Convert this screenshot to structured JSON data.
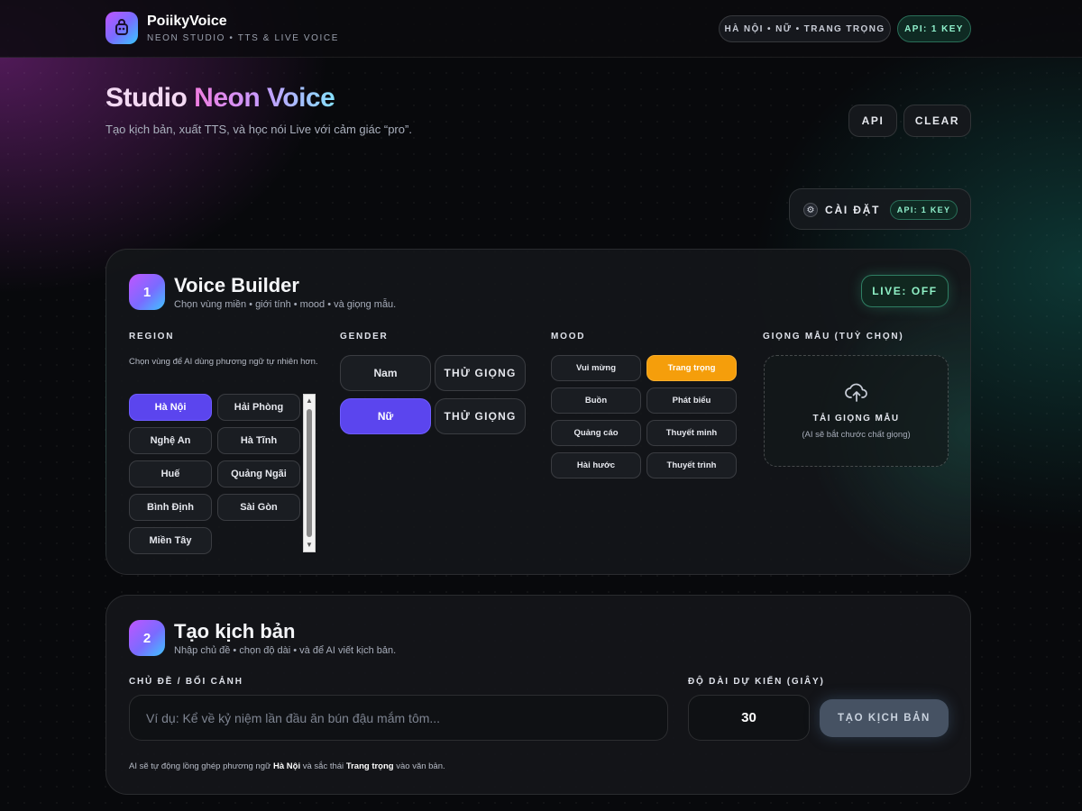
{
  "header": {
    "app_name": "PoiikyVoice",
    "tagline": "NEON STUDIO • TTS & LIVE VOICE",
    "status_pill": "HÀ NỘI • NỮ • TRANG TRỌNG",
    "api_pill": "API: 1 KEY",
    "logo_icon": "robot-icon"
  },
  "hero": {
    "title_part1": "Studio",
    "title_part2": "Neon Voice",
    "subtitle": "Tạo kịch bản, xuất TTS, và học nói Live với cảm giác “pro”.",
    "api_button": "API",
    "clear_button": "CLEAR"
  },
  "settings": {
    "label": "CÀI ĐẶT",
    "api_badge": "API: 1 KEY",
    "icon": "gear-icon"
  },
  "voice_builder": {
    "step": "1",
    "title": "Voice Builder",
    "subtitle": "Chọn vùng miền • giới tính • mood • và giọng mẫu.",
    "live_badge": "LIVE: OFF",
    "region": {
      "label": "REGION",
      "help": "Chọn vùng để AI dùng phương ngữ tự nhiên hơn.",
      "items": [
        "Hà Nội",
        "Hải Phòng",
        "Nghệ An",
        "Hà Tĩnh",
        "Huế",
        "Quảng Ngãi",
        "Bình Định",
        "Sài Gòn",
        "Miền Tây"
      ],
      "selected": "Hà Nội"
    },
    "gender": {
      "label": "GENDER",
      "options": [
        "Nam",
        "Nữ"
      ],
      "try_label": "THỬ GIỌNG",
      "selected": "Nữ"
    },
    "mood": {
      "label": "MOOD",
      "items": [
        "Vui mừng",
        "Trang trọng",
        "Buồn",
        "Phát biểu",
        "Quảng cáo",
        "Thuyết minh",
        "Hài hước",
        "Thuyết trình"
      ],
      "selected": "Trang trọng"
    },
    "sample": {
      "label": "GIỌNG MẪU (TUỲ CHỌN)",
      "upload_title": "TẢI GIỌNG MẪU",
      "upload_hint": "(AI sẽ bắt chước chất giọng)",
      "icon": "cloud-upload-icon"
    }
  },
  "script_builder": {
    "step": "2",
    "title": "Tạo kịch bản",
    "subtitle": "Nhập chủ đề • chọn độ dài • và để AI viết kịch bản.",
    "topic_label": "CHỦ ĐỀ / BỐI CẢNH",
    "topic_placeholder": "Ví dụ: Kể về kỷ niệm lần đầu ăn bún đậu mắm tôm...",
    "length_label": "ĐỘ DÀI DỰ KIẾN (GIÂY)",
    "length_value": "30",
    "generate_button": "TẠO KỊCH BẢN",
    "note_prefix": "AI sẽ tự động lồng ghép phương ngữ",
    "note_region": "Hà Nội",
    "note_middle": "và sắc thái",
    "note_mood": "Trang trọng",
    "note_suffix": "vào văn bản."
  }
}
